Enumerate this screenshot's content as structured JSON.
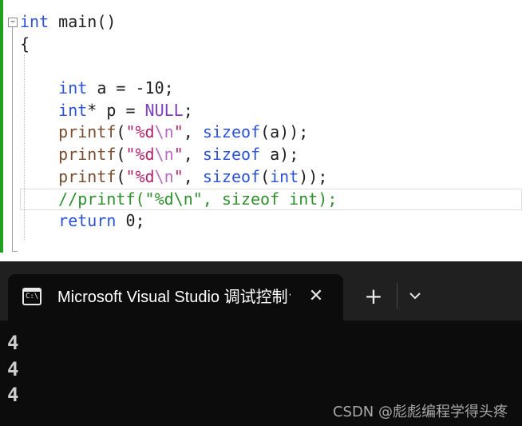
{
  "editor": {
    "lines": [
      [
        {
          "t": "int",
          "c": "kw"
        },
        {
          "t": " main()",
          "c": ""
        }
      ],
      [
        {
          "t": "{",
          "c": ""
        }
      ],
      [
        {
          "t": "",
          "c": ""
        }
      ],
      [
        {
          "t": "    ",
          "c": ""
        },
        {
          "t": "int",
          "c": "kw"
        },
        {
          "t": " a = -10;",
          "c": ""
        }
      ],
      [
        {
          "t": "    ",
          "c": ""
        },
        {
          "t": "int",
          "c": "kw"
        },
        {
          "t": "* p = ",
          "c": ""
        },
        {
          "t": "NULL",
          "c": "mac"
        },
        {
          "t": ";",
          "c": ""
        }
      ],
      [
        {
          "t": "    ",
          "c": ""
        },
        {
          "t": "printf",
          "c": "fn"
        },
        {
          "t": "(",
          "c": ""
        },
        {
          "t": "\"%d",
          "c": "str"
        },
        {
          "t": "\\n",
          "c": "esc"
        },
        {
          "t": "\"",
          "c": "str"
        },
        {
          "t": ", ",
          "c": ""
        },
        {
          "t": "sizeof",
          "c": "kw"
        },
        {
          "t": "(a));",
          "c": ""
        }
      ],
      [
        {
          "t": "    ",
          "c": ""
        },
        {
          "t": "printf",
          "c": "fn"
        },
        {
          "t": "(",
          "c": ""
        },
        {
          "t": "\"%d",
          "c": "str"
        },
        {
          "t": "\\n",
          "c": "esc"
        },
        {
          "t": "\"",
          "c": "str"
        },
        {
          "t": ", ",
          "c": ""
        },
        {
          "t": "sizeof",
          "c": "kw"
        },
        {
          "t": " a);",
          "c": ""
        }
      ],
      [
        {
          "t": "    ",
          "c": ""
        },
        {
          "t": "printf",
          "c": "fn"
        },
        {
          "t": "(",
          "c": ""
        },
        {
          "t": "\"%d",
          "c": "str"
        },
        {
          "t": "\\n",
          "c": "esc"
        },
        {
          "t": "\"",
          "c": "str"
        },
        {
          "t": ", ",
          "c": ""
        },
        {
          "t": "sizeof",
          "c": "kw"
        },
        {
          "t": "(",
          "c": ""
        },
        {
          "t": "int",
          "c": "kw"
        },
        {
          "t": "));",
          "c": ""
        }
      ],
      [
        {
          "t": "    ",
          "c": ""
        },
        {
          "t": "//printf(\"%d\\n\", sizeof int);",
          "c": "cmt"
        }
      ],
      [
        {
          "t": "    ",
          "c": ""
        },
        {
          "t": "return",
          "c": "kw"
        },
        {
          "t": " 0;",
          "c": ""
        }
      ],
      [
        {
          "t": "",
          "c": ""
        }
      ],
      [
        {
          "t": "",
          "c": ""
        }
      ],
      [
        {
          "t": "}",
          "c": ""
        }
      ]
    ],
    "highlighted_line": 8
  },
  "terminal": {
    "tab_title": "Microsoft Visual Studio 调试控制台",
    "close_glyph": "✕",
    "new_tab_glyph": "+",
    "output": [
      "4",
      "4",
      "4"
    ]
  },
  "watermark": "CSDN @彪彪编程学得头疼",
  "colors": {
    "keyword": "#2b52d9",
    "function": "#7a4d2f",
    "string": "#b0226b",
    "escape": "#b86cc0",
    "macro": "#7e3fbf",
    "comment": "#2f8f2f",
    "change_bar": "#1fa01f",
    "terminal_bg": "#0c0c0c",
    "tabbar_bg": "#202020"
  }
}
